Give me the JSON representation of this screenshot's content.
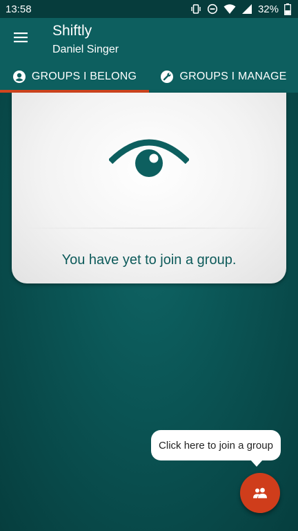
{
  "status_bar": {
    "time": "13:58",
    "battery_percent": "32%",
    "icons": [
      "vibrate-icon",
      "do-not-disturb-icon",
      "wifi-icon",
      "signal-icon",
      "battery-icon"
    ]
  },
  "app_bar": {
    "title": "Shiftly",
    "subtitle": "Daniel Singer",
    "menu_icon": "hamburger-menu-icon"
  },
  "tabs": [
    {
      "label": "GROUPS I BELONG",
      "icon": "group-member-icon",
      "selected": true
    },
    {
      "label": "GROUPS I MANAGE",
      "icon": "group-manage-icon",
      "selected": false
    }
  ],
  "empty_state": {
    "icon": "eye-icon",
    "message": "You have yet to join a group."
  },
  "tooltip": {
    "text": "Click here to join a group"
  },
  "fab": {
    "icon": "people-icon"
  },
  "colors": {
    "primary": "#0d5f5f",
    "accent": "#cf3d1b",
    "status_bar": "#063c3c",
    "text_on_card": "#0d5a5a"
  }
}
